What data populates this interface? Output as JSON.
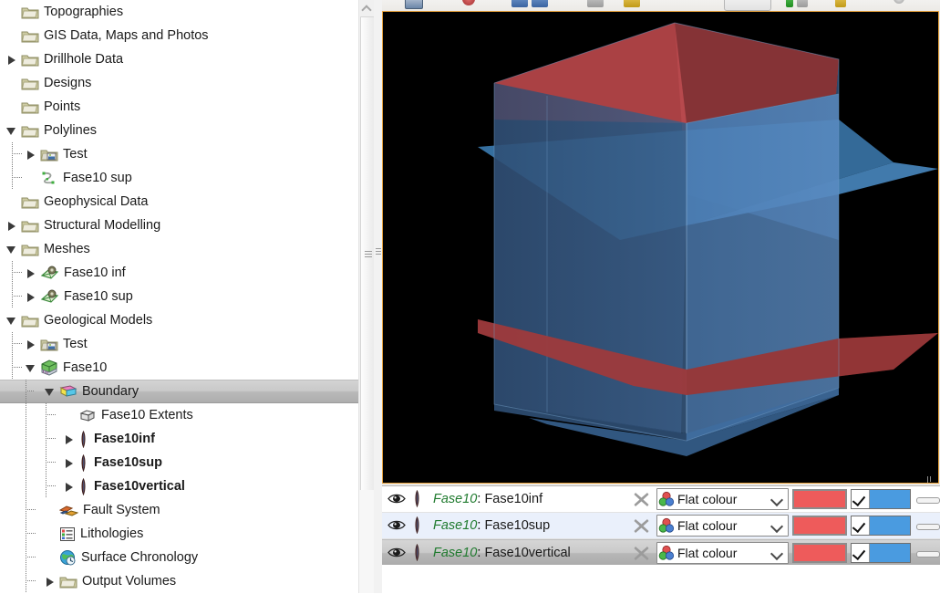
{
  "tree": {
    "name": "project-explorer-tree",
    "items": [
      {
        "label": "Topographies",
        "indent": 1,
        "icon": "folder-icon",
        "twisty": "none",
        "bold": false
      },
      {
        "label": "GIS Data, Maps and Photos",
        "indent": 1,
        "icon": "folder-icon",
        "twisty": "none",
        "bold": false
      },
      {
        "label": "Drillhole Data",
        "indent": 1,
        "icon": "folder-icon",
        "twisty": "collapsed",
        "bold": false
      },
      {
        "label": "Designs",
        "indent": 1,
        "icon": "folder-icon",
        "twisty": "none",
        "bold": false
      },
      {
        "label": "Points",
        "indent": 1,
        "icon": "folder-icon",
        "twisty": "none",
        "bold": false
      },
      {
        "label": "Polylines",
        "indent": 1,
        "icon": "folder-icon",
        "twisty": "expanded",
        "bold": false
      },
      {
        "label": "Test",
        "indent": 2,
        "icon": "folder-picture-icon",
        "twisty": "collapsed",
        "bold": false
      },
      {
        "label": "Fase10 sup",
        "indent": 2,
        "icon": "polyline-icon",
        "twisty": "none",
        "bold": false
      },
      {
        "label": "Geophysical Data",
        "indent": 1,
        "icon": "folder-icon",
        "twisty": "none",
        "bold": false
      },
      {
        "label": "Structural Modelling",
        "indent": 1,
        "icon": "folder-icon",
        "twisty": "collapsed",
        "bold": false
      },
      {
        "label": "Meshes",
        "indent": 1,
        "icon": "folder-icon",
        "twisty": "expanded",
        "bold": false
      },
      {
        "label": "Fase10 inf",
        "indent": 2,
        "icon": "mesh-icon",
        "twisty": "collapsed",
        "bold": false
      },
      {
        "label": "Fase10 sup",
        "indent": 2,
        "icon": "mesh-icon",
        "twisty": "collapsed",
        "bold": false
      },
      {
        "label": "Geological Models",
        "indent": 1,
        "icon": "folder-icon",
        "twisty": "expanded",
        "bold": false
      },
      {
        "label": "Test",
        "indent": 2,
        "icon": "folder-picture-icon",
        "twisty": "collapsed",
        "bold": false
      },
      {
        "label": "Fase10",
        "indent": 2,
        "icon": "geological-model-icon",
        "twisty": "expanded",
        "bold": false
      },
      {
        "label": "Boundary",
        "indent": 3,
        "icon": "boundary-icon",
        "twisty": "expanded",
        "bold": false,
        "selected": true
      },
      {
        "label": "Fase10 Extents",
        "indent": 4,
        "icon": "extents-icon",
        "twisty": "none",
        "bold": false
      },
      {
        "label": "Fase10inf",
        "indent": 4,
        "icon": "surface-icon",
        "twisty": "collapsed",
        "bold": true
      },
      {
        "label": "Fase10sup",
        "indent": 4,
        "icon": "surface-icon",
        "twisty": "collapsed",
        "bold": true
      },
      {
        "label": "Fase10vertical",
        "indent": 4,
        "icon": "surface-icon",
        "twisty": "collapsed",
        "bold": true
      },
      {
        "label": "Fault System",
        "indent": 3,
        "icon": "fault-system-icon",
        "twisty": "none",
        "bold": false
      },
      {
        "label": "Lithologies",
        "indent": 3,
        "icon": "lithologies-icon",
        "twisty": "none",
        "bold": false
      },
      {
        "label": "Surface Chronology",
        "indent": 3,
        "icon": "surface-chronology-icon",
        "twisty": "none",
        "bold": false
      },
      {
        "label": "Output Volumes",
        "indent": 3,
        "icon": "folder-icon",
        "twisty": "collapsed",
        "bold": false
      }
    ]
  },
  "viewport": {
    "name": "3d-scene-viewport",
    "background": "#000000",
    "border_color": "#e8a33d",
    "objects": [
      {
        "name": "Fase10vertical",
        "kind": "vertical-prism",
        "color": "#4a7fb5",
        "opacity": 0.72
      },
      {
        "name": "Fase10sup",
        "kind": "upper-surface-plane",
        "color": "#c9494c"
      },
      {
        "name": "Fase10inf",
        "kind": "lower-surface-plane",
        "color": "#b0403f"
      },
      {
        "name": "mid-plane",
        "kind": "intersecting-plane",
        "color": "#3f7cb0"
      }
    ]
  },
  "layers": {
    "name": "scene-layer-list",
    "columns": [
      "visibility",
      "icon",
      "name",
      "remove",
      "colour-mode",
      "colour",
      "opacity-check",
      "opacity-slider"
    ],
    "rows": [
      {
        "visible": true,
        "prefix": "Fase10",
        "sep": ": ",
        "name": "Fase10inf",
        "colour_mode": "Flat colour",
        "colour": "#ee5b5b",
        "check": true,
        "check_colour": "#4a9be0",
        "state": "normal"
      },
      {
        "visible": true,
        "prefix": "Fase10",
        "sep": ": ",
        "name": "Fase10sup",
        "colour_mode": "Flat colour",
        "colour": "#ee5b5b",
        "check": true,
        "check_colour": "#4a9be0",
        "state": "alt"
      },
      {
        "visible": true,
        "prefix": "Fase10",
        "sep": ": ",
        "name": "Fase10vertical",
        "colour_mode": "Flat colour",
        "colour": "#ee5b5b",
        "check": true,
        "check_colour": "#4a9be0",
        "state": "selected"
      }
    ]
  },
  "colors": {
    "accent_red": "#ee5b5b",
    "accent_blue": "#4a9be0",
    "viewport_border": "#e8a33d",
    "prefix_green": "#1f7a2e",
    "selection_gray": "#c9c9c9"
  }
}
